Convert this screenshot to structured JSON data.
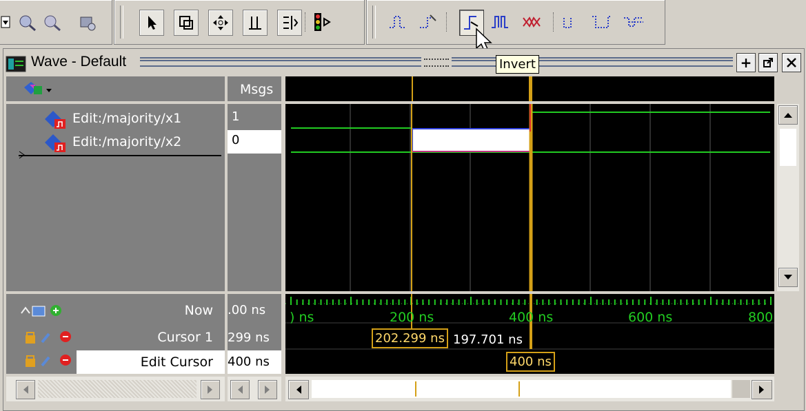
{
  "window": {
    "title": "Wave - Default"
  },
  "tooltip": {
    "text": "Invert"
  },
  "columns": {
    "msgs_header": "Msgs"
  },
  "signals": [
    {
      "name": "Edit:/majority/x1",
      "value": "1"
    },
    {
      "name": "Edit:/majority/x2",
      "value": "0"
    }
  ],
  "cursors": {
    "now": {
      "label": "Now",
      "value": ".00 ns"
    },
    "cursor1": {
      "label": "Cursor 1",
      "value": "299 ns"
    },
    "edit": {
      "label": "Edit Cursor",
      "value": "400 ns"
    }
  },
  "timeline": {
    "ticks": [
      ") ns",
      "200 ns",
      "400 ns",
      "600 ns",
      "800"
    ],
    "cursor1_time": "202.299 ns",
    "delta": "197.701 ns",
    "edit_time": "400 ns"
  },
  "colors": {
    "wave_green": "#22cc22",
    "cursor_yellow": "#d4a017",
    "background": "#000000"
  }
}
